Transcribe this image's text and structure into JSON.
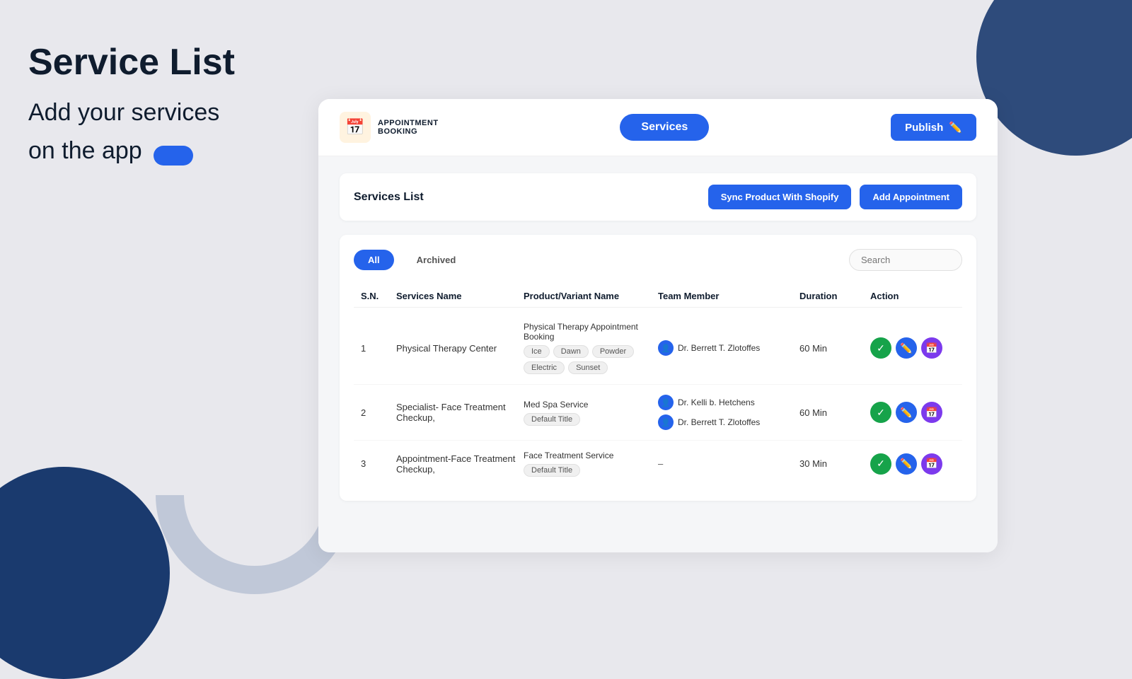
{
  "page": {
    "title": "Service List",
    "subtitle_line1": "Add your services",
    "subtitle_line2": "on the app"
  },
  "app": {
    "logo_icon": "📅",
    "logo_line1": "APPOINTMENT",
    "logo_line2": "BOOKING",
    "nav_button": "Services",
    "publish_button": "Publish",
    "publish_icon": "✏️"
  },
  "services_panel": {
    "title": "Services List",
    "sync_button": "Sync Product With Shopify",
    "add_button": "Add Appointment"
  },
  "filters": {
    "tab_all": "All",
    "tab_archived": "Archived",
    "search_placeholder": "Search"
  },
  "table": {
    "columns": [
      "S.N.",
      "Services Name",
      "Product/Variant Name",
      "Team Member",
      "Duration",
      "Action"
    ],
    "rows": [
      {
        "num": "1",
        "service_name": "Physical Therapy Center",
        "product_name": "Physical Therapy Appointment Booking",
        "variants": [
          "Ice",
          "Dawn",
          "Powder",
          "Electric",
          "Sunset"
        ],
        "team_members": [
          "Dr. Berrett T. Zlotoffes"
        ],
        "duration": "60 Min"
      },
      {
        "num": "2",
        "service_name": "Specialist- Face Treatment Checkup,",
        "product_name": "Med Spa Service",
        "variants": [
          "Default Title"
        ],
        "team_members": [
          "Dr. Kelli b. Hetchens",
          "Dr. Berrett T. Zlotoffes"
        ],
        "duration": "60 Min"
      },
      {
        "num": "3",
        "service_name": "Appointment-Face Treatment Checkup,",
        "product_name": "Face Treatment Service",
        "variants": [
          "Default Title"
        ],
        "team_members": [],
        "duration": "30 Min",
        "no_team": true
      }
    ]
  }
}
